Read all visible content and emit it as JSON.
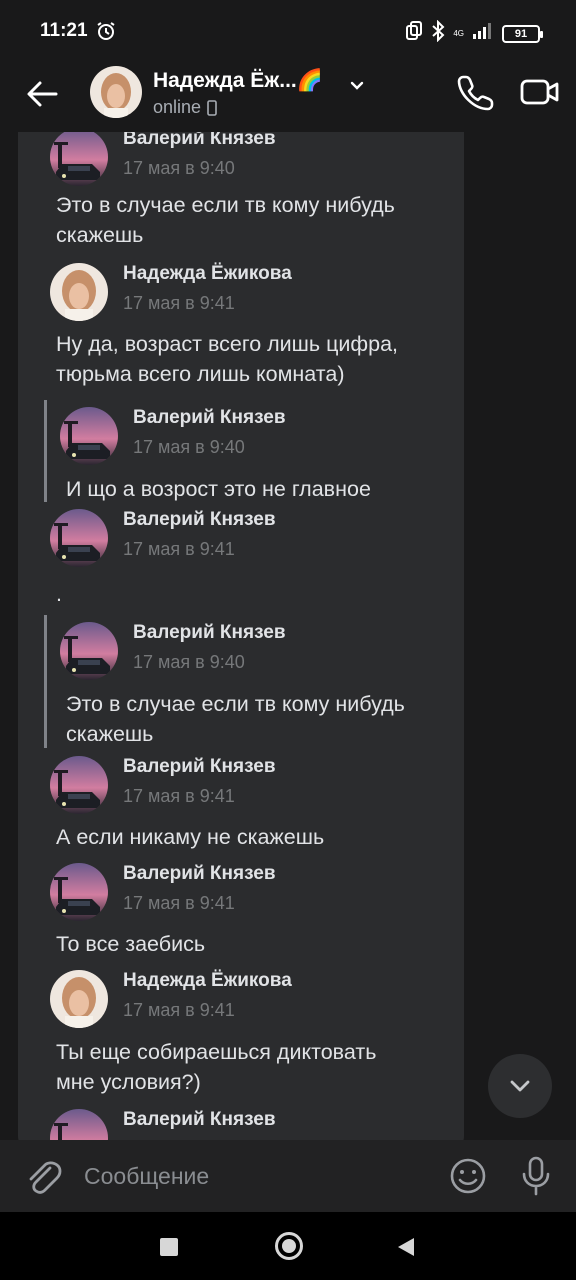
{
  "status": {
    "time": "11:21",
    "network": "4G",
    "battery": "91"
  },
  "header": {
    "name": "Надежда Ёж...",
    "name_emoji": "🌈",
    "presence": "online"
  },
  "messages": [
    {
      "type": "forward",
      "name": "Валерий Князев",
      "time": "17 мая в 9:40",
      "avatar": "car"
    },
    {
      "type": "text",
      "lines": [
        "Это в случае если тв кому нибудь",
        "скажешь"
      ]
    },
    {
      "type": "forward",
      "name": "Надежда Ёжикова",
      "time": "17 мая в 9:41",
      "avatar": "girl"
    },
    {
      "type": "text",
      "lines": [
        "Ну да, возраст всего лишь цифра,",
        "тюрьма всего лишь комната)"
      ]
    },
    {
      "type": "forward",
      "name": "Валерий Князев",
      "time": "17 мая в 9:40",
      "avatar": "car"
    },
    {
      "type": "text",
      "lines": [
        "И що а возрост это не главное"
      ]
    },
    {
      "type": "forward",
      "name": "Валерий Князев",
      "time": "17 мая в 9:41",
      "avatar": "car"
    },
    {
      "type": "text",
      "lines": [
        "."
      ]
    },
    {
      "type": "forward",
      "name": "Валерий Князев",
      "time": "17 мая в 9:40",
      "avatar": "car"
    },
    {
      "type": "text",
      "lines": [
        "Это в случае если тв кому нибудь",
        "скажешь"
      ]
    },
    {
      "type": "forward",
      "name": "Валерий Князев",
      "time": "17 мая в 9:41",
      "avatar": "car"
    },
    {
      "type": "text",
      "lines": [
        "А если никаму не скажешь"
      ]
    },
    {
      "type": "forward",
      "name": "Валерий Князев",
      "time": "17 мая в 9:41",
      "avatar": "car"
    },
    {
      "type": "text",
      "lines": [
        "То все заебись"
      ]
    },
    {
      "type": "forward",
      "name": "Надежда Ёжикова",
      "time": "17 мая в 9:41",
      "avatar": "girl"
    },
    {
      "type": "text",
      "lines": [
        "Ты еще собираешься диктовать",
        "мне условия?)"
      ]
    },
    {
      "type": "forward",
      "name": "Валерий Князев",
      "time": "",
      "avatar": "car"
    }
  ],
  "composer": {
    "placeholder": "Сообщение"
  },
  "icons": {
    "back": "arrow-left-icon",
    "phone": "phone-icon",
    "video": "video-camera-icon",
    "attach": "paperclip-icon",
    "emoji": "smiley-icon",
    "mic": "microphone-icon",
    "scroll": "chevron-down-icon"
  },
  "colors": {
    "background": "#19191a",
    "bubble": "#2b2c2e",
    "text": "#e1e3e6",
    "muted": "#76787a"
  }
}
